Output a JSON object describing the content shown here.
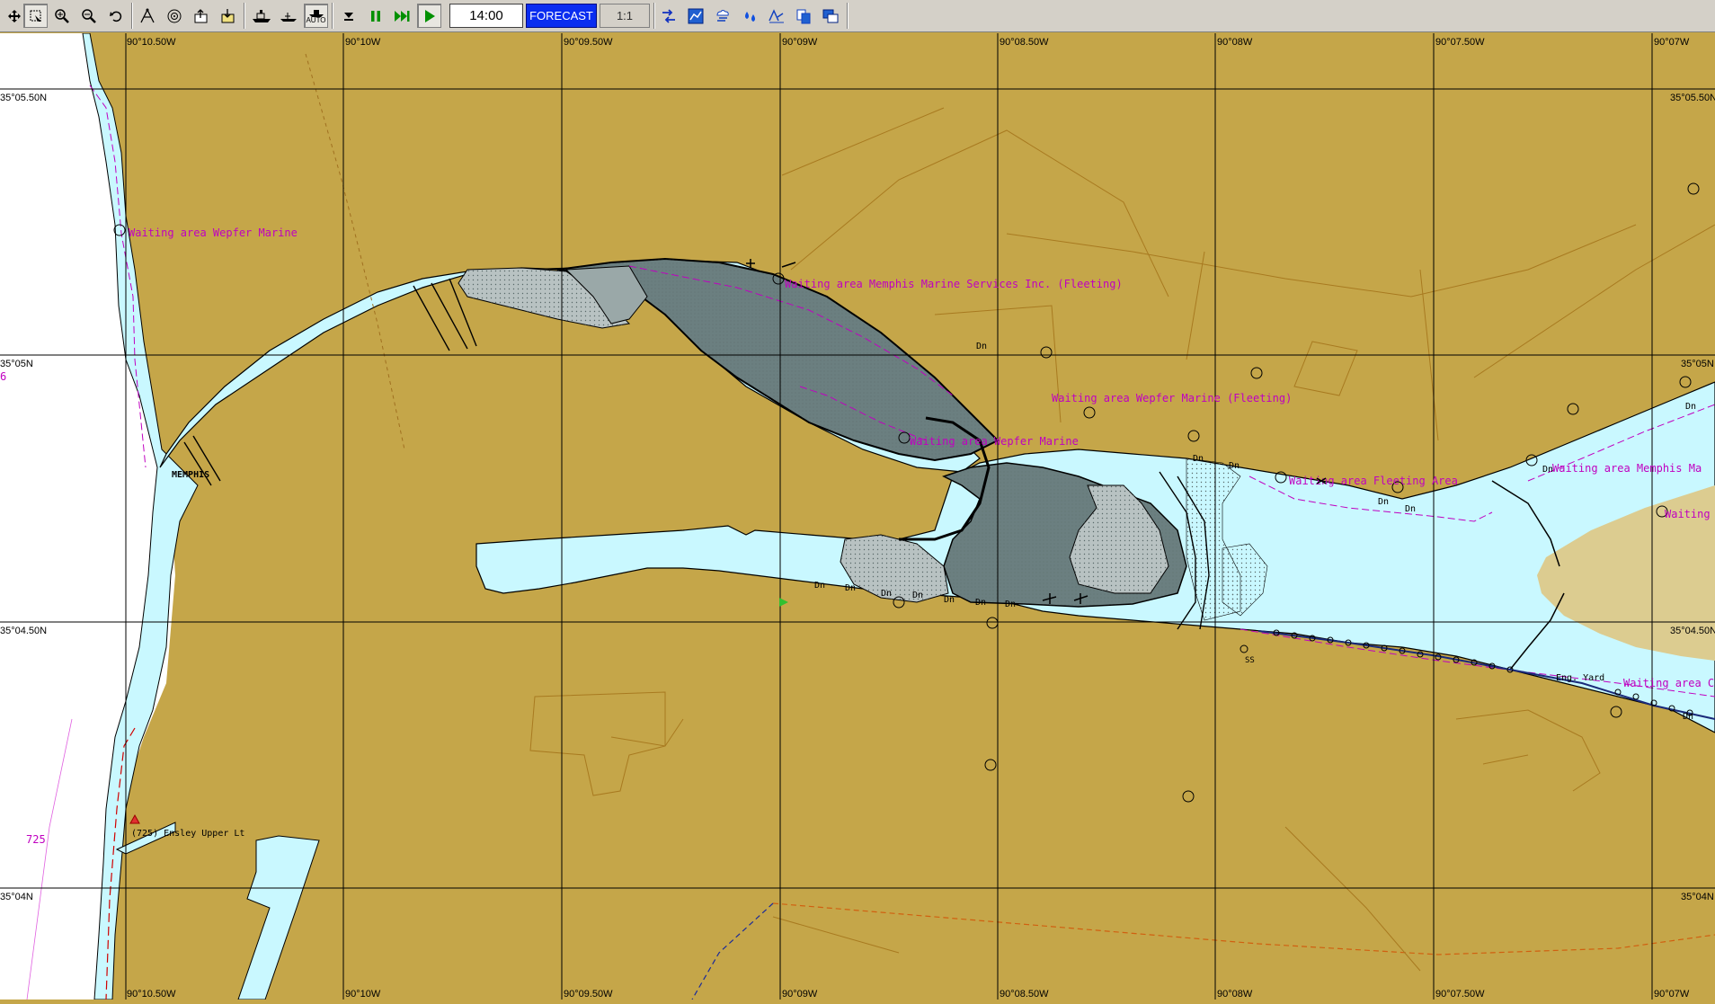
{
  "toolbar": {
    "tools": [
      {
        "name": "move-tool",
        "icon": "move-arrows-icon"
      },
      {
        "name": "select-tool",
        "icon": "select-box-icon",
        "pressed": true
      },
      {
        "name": "zoom-in-tool",
        "icon": "zoom-in-icon"
      },
      {
        "name": "zoom-out-tool",
        "icon": "zoom-out-icon"
      },
      {
        "name": "undo-tool",
        "icon": "undo-icon"
      }
    ],
    "time_value": "14:00",
    "forecast_label": "FORECAST",
    "scale_value": "1:1",
    "auto_label": "AUTO"
  },
  "grid": {
    "top_lon_labels": [
      "90°10.50W",
      "90°10W",
      "90°09.50W",
      "90°09W",
      "90°08.50W",
      "90°08W",
      "90°07.50W",
      "90°07W"
    ],
    "bottom_lon_labels": [
      "90°10.50W",
      "90°10W",
      "90°09.50W",
      "90°09W",
      "90°08.50W",
      "90°08W",
      "90°07.50W",
      "90°07W"
    ],
    "left_lat_labels": [
      "35°05.50N",
      "35°05N",
      "35°04.50N",
      "35°04N"
    ],
    "right_lat_labels": [
      "35°05.50N",
      "35°05N",
      "35°04.50N",
      "35°04N"
    ]
  },
  "labels": {
    "waiting_wepfer_1": "Waiting area Wepfer Marine",
    "waiting_memphis_services": "Waiting area Memphis Marine Services Inc. (Fleeting)",
    "waiting_wepfer_fleeting": "Waiting area Wepfer Marine (Fleeting)",
    "waiting_wepfer_2": "Waiting area Wepfer Marine",
    "waiting_fleeting_area": "Waiting area Fleeting Area",
    "waiting_memphis_right": "Waiting area Memphis Ma",
    "waiting_right_small": "Waiting",
    "waiting_cory": "Waiting area Cory",
    "memphis": "MEMPHIS",
    "light_name": "(725) Ensley Upper Lt",
    "mile_725": "725",
    "left_edge_digit": "6",
    "ss": "SS",
    "eng_yard": "Eng. Yard",
    "dn_labels": [
      "Dn",
      "Dn",
      "Dn",
      "Dn",
      "Dn",
      "Dn",
      "Dn",
      "Dn",
      "Dn",
      "Dn",
      "Dn",
      "Dn",
      "Dn",
      "Dn",
      "Dn"
    ]
  },
  "colors": {
    "land": "#c5a649",
    "water": "#c9f8ff",
    "white_area": "#ffffff",
    "deep_shoal": "#6b7f80",
    "shoal": "#b8c2c2",
    "magenta": "#c000c0",
    "tan_area": "#dccc90"
  }
}
